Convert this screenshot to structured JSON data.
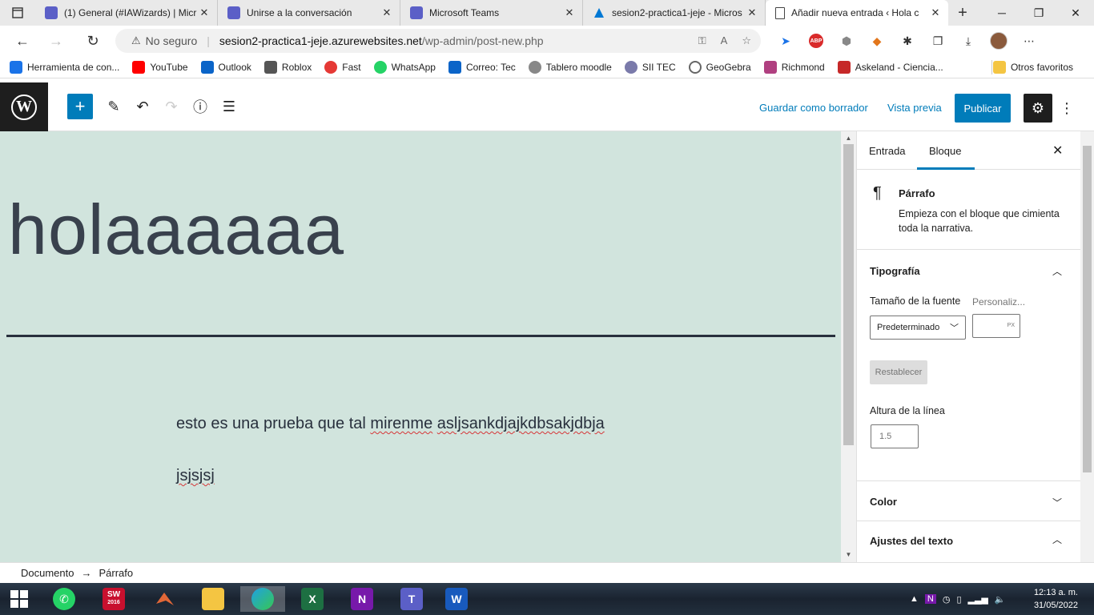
{
  "browser": {
    "tabs": [
      {
        "title": "(1) General (#IAWizards) | Micr",
        "icon": "teams-icon",
        "active": false
      },
      {
        "title": "Unirse a la conversación",
        "icon": "teams-icon",
        "active": false
      },
      {
        "title": "Microsoft Teams",
        "icon": "teams-icon",
        "active": false
      },
      {
        "title": "sesion2-practica1-jeje - Micros",
        "icon": "azure-icon",
        "active": false
      },
      {
        "title": "Añadir nueva entrada ‹ Hola c",
        "icon": "page-icon",
        "active": true
      }
    ],
    "address": {
      "security_label": "No seguro",
      "host": "sesion2-practica1-jeje.azurewebsites.net",
      "path": "/wp-admin/post-new.php"
    },
    "bookmarks": [
      {
        "label": "Herramienta de con...",
        "color": "#1a73e8"
      },
      {
        "label": "YouTube",
        "color": "#ff0000"
      },
      {
        "label": "Outlook",
        "color": "#0a64c8"
      },
      {
        "label": "Roblox",
        "color": "#555555"
      },
      {
        "label": "Fast",
        "color": "#e53935"
      },
      {
        "label": "WhatsApp",
        "color": "#25d366"
      },
      {
        "label": "Correo: Tec",
        "color": "#0a64c8"
      },
      {
        "label": "Tablero moodle",
        "color": "#888888"
      },
      {
        "label": "SII TEC",
        "color": "#7a7aaa"
      },
      {
        "label": "GeoGebra",
        "color": "#666666"
      },
      {
        "label": "Richmond",
        "color": "#b04080"
      },
      {
        "label": "Askeland - Ciencia...",
        "color": "#c62828"
      }
    ],
    "other_favorites": "Otros favoritos"
  },
  "editor": {
    "toolbar": {
      "save_draft": "Guardar como borrador",
      "preview": "Vista previa",
      "publish": "Publicar"
    },
    "post_title": "holaaaaaa",
    "paragraphs": {
      "p1_plain": "esto es una prueba que tal ",
      "p1_word1": "mirenme",
      "p1_space": " ",
      "p1_word2": "asljsankdjajkdbsakjdbja",
      "p2": "jsjsjsj"
    },
    "breadcrumb": {
      "document": "Documento",
      "arrow": "→",
      "block": "Párrafo"
    }
  },
  "sidebar": {
    "tab_post": "Entrada",
    "tab_block": "Bloque",
    "block_name": "Párrafo",
    "block_description": "Empieza con el bloque que cimienta toda la narrativa.",
    "typography": {
      "heading": "Tipografía",
      "font_size_label": "Tamaño de la fuente",
      "custom_label": "Personaliz...",
      "font_size_value": "Predeterminado",
      "unit": "PX",
      "reset": "Restablecer",
      "line_height_label": "Altura de la línea",
      "line_height_placeholder": "1.5"
    },
    "color_heading": "Color",
    "text_settings_heading": "Ajustes del texto"
  },
  "taskbar": {
    "time": "12:13 a. m.",
    "date": "31/05/2022",
    "apps": [
      "start",
      "whatsapp",
      "solidworks-2016",
      "matlab",
      "file-explorer",
      "edge",
      "excel",
      "onenote",
      "teams",
      "word"
    ],
    "sw_label": "SW",
    "sw_year": "2016"
  },
  "colors": {
    "wp_blue": "#007cba",
    "canvas_bg": "#d1e4dd",
    "wp_dark": "#1e1e1e"
  }
}
